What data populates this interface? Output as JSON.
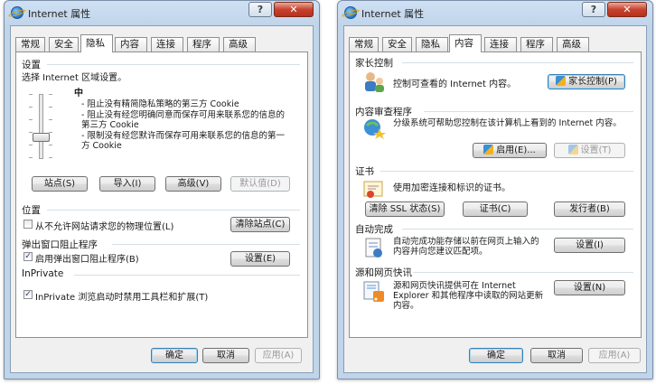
{
  "window_left": {
    "title": "Internet 属性",
    "help": "?",
    "close": "✕",
    "tabs": [
      "常规",
      "安全",
      "隐私",
      "内容",
      "连接",
      "程序",
      "高级"
    ],
    "settings": {
      "group_title": "设置",
      "prompt": "选择 Internet 区域设置。",
      "level": "中",
      "bullets": [
        "- 阻止没有精简隐私策略的第三方 Cookie",
        "- 阻止没有经您明确同意而保存可用来联系您的信息的第三方 Cookie",
        "- 限制没有经您默许而保存可用来联系您的信息的第一方 Cookie"
      ],
      "buttons": [
        "站点(S)",
        "导入(I)",
        "高级(V)",
        "默认值(D)"
      ]
    },
    "location": {
      "group_title": "位置",
      "checkbox_label": "从不允许网站请求您的物理位置(L)",
      "checked": false,
      "clear_button": "清除站点(C)"
    },
    "popup": {
      "group_title": "弹出窗口阻止程序",
      "checkbox_label": "启用弹出窗口阻止程序(B)",
      "checked": true,
      "settings_button": "设置(E)"
    },
    "inprivate": {
      "group_title": "InPrivate",
      "checkbox_label": "InPrivate 浏览启动时禁用工具栏和扩展(T)",
      "checked": true
    },
    "footer": [
      "确定",
      "取消",
      "应用(A)"
    ]
  },
  "window_right": {
    "title": "Internet 属性",
    "help": "?",
    "close": "✕",
    "tabs": [
      "常规",
      "安全",
      "隐私",
      "内容",
      "连接",
      "程序",
      "高级"
    ],
    "parental": {
      "group_title": "家长控制",
      "desc": "控制可查看的 Internet 内容。",
      "button": "家长控制(P)"
    },
    "advisor": {
      "group_title": "内容审查程序",
      "desc": "分级系统可帮助您控制在该计算机上看到的 Internet 内容。",
      "enable_button": "启用(E)...",
      "settings_button": "设置(T)"
    },
    "certs": {
      "group_title": "证书",
      "desc": "使用加密连接和标识的证书。",
      "buttons": [
        "清除 SSL 状态(S)",
        "证书(C)",
        "发行者(B)"
      ]
    },
    "autocomplete": {
      "group_title": "自动完成",
      "desc": "自动完成功能存储以前在网页上输入的内容并向您建议匹配项。",
      "button": "设置(I)"
    },
    "feeds": {
      "group_title": "源和网页快讯",
      "desc": "源和网页快讯提供可在 Internet Explorer 和其他程序中读取的网站更新内容。",
      "button": "设置(N)"
    },
    "footer": [
      "确定",
      "取消",
      "应用(A)"
    ]
  },
  "colors": {
    "title_bg": "#c0d4ea",
    "close_red": "#c7432f",
    "panel_bg": "#ffffff",
    "client_bg": "#f0f0f0"
  }
}
